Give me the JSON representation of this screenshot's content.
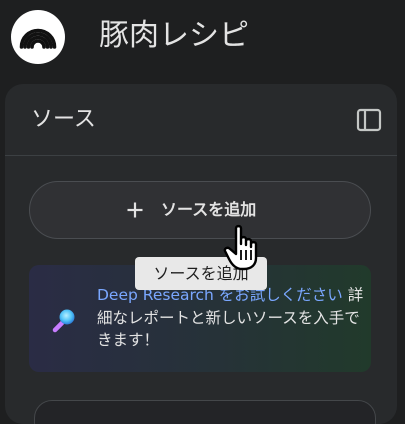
{
  "header": {
    "title": "豚肉レシピ",
    "logo_icon": "notebook-logo-icon"
  },
  "sources_panel": {
    "title": "ソース",
    "toggle_icon": "panel-toggle-icon",
    "add_source_label": "ソースを追加",
    "add_icon": "plus-icon",
    "tooltip": "ソースを追加",
    "promo": {
      "icon": "magnifier-icon",
      "link_text": "Deep Research をお試しください",
      "body_text": " 詳細なレポートと新しいソースを入手できます！"
    }
  },
  "colors": {
    "background": "#1e1f20",
    "panel": "#282a2c",
    "link": "#7aa7ff",
    "tooltip_bg": "#e8e8e8"
  }
}
